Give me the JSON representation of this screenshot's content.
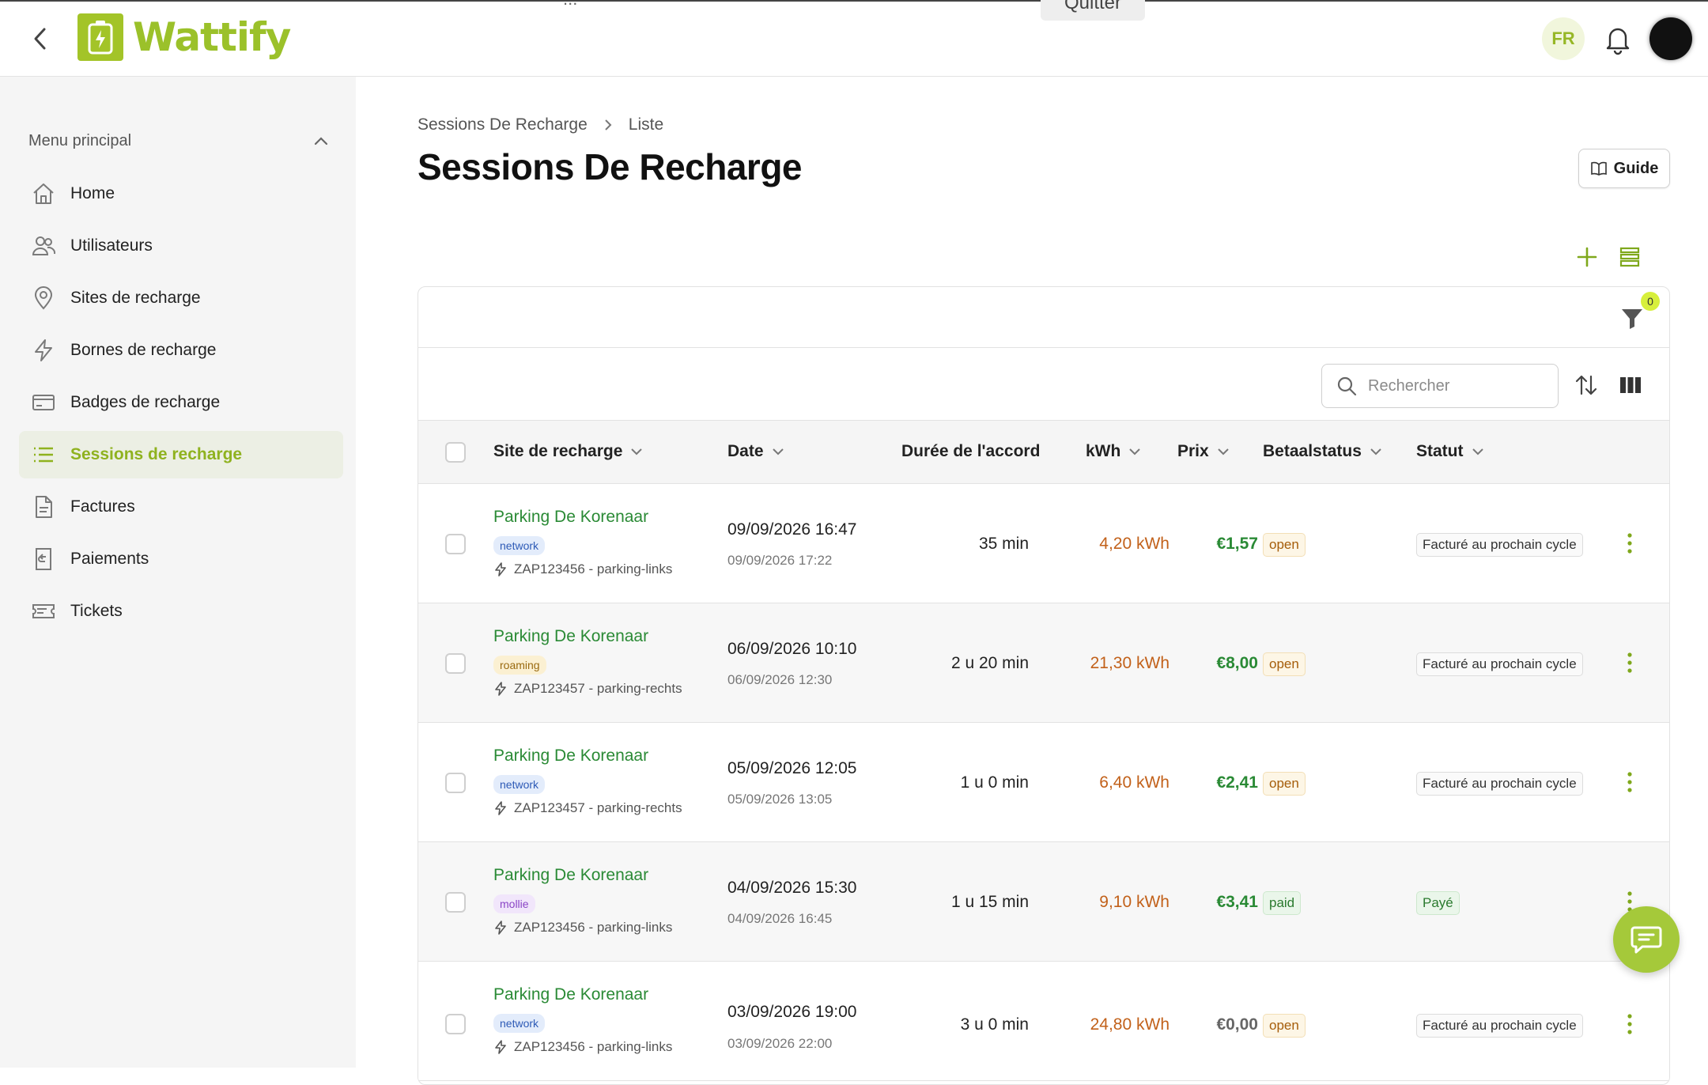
{
  "header": {
    "brand": "Wattify",
    "ghost_text": "...",
    "ghost_button": "Quitter",
    "lang": "FR",
    "accent": "#a3c428"
  },
  "sidebar": {
    "heading": "Menu principal",
    "items": [
      {
        "label": "Home",
        "icon": "home-icon"
      },
      {
        "label": "Utilisateurs",
        "icon": "users-icon"
      },
      {
        "label": "Sites de recharge",
        "icon": "map-pin-icon"
      },
      {
        "label": "Bornes de recharge",
        "icon": "lightning-icon"
      },
      {
        "label": "Badges de recharge",
        "icon": "card-icon"
      },
      {
        "label": "Sessions de recharge",
        "icon": "list-icon",
        "active": true
      },
      {
        "label": "Factures",
        "icon": "document-icon"
      },
      {
        "label": "Paiements",
        "icon": "receipt-icon"
      },
      {
        "label": "Tickets",
        "icon": "ticket-icon"
      }
    ]
  },
  "breadcrumb": {
    "parent": "Sessions De Recharge",
    "current": "Liste"
  },
  "page": {
    "title": "Sessions De Recharge",
    "guide_label": "Guide"
  },
  "filters": {
    "count": "0"
  },
  "search": {
    "placeholder": "Rechercher"
  },
  "table": {
    "columns": [
      "Site de recharge",
      "Date",
      "Durée de l'accord",
      "kWh",
      "Prix",
      "Betaalstatus",
      "Statut"
    ],
    "rows": [
      {
        "site": "Parking De Korenaar",
        "tag": "network",
        "charger": "ZAP123456 - parking-links",
        "date": "09/09/2026 16:47",
        "date_end": "09/09/2026 17:22",
        "duration": "35 min",
        "kwh": "4,20 kWh",
        "prix": "€1,57",
        "pay": "open",
        "status": "Facturé au prochain cycle"
      },
      {
        "site": "Parking De Korenaar",
        "tag": "roaming",
        "charger": "ZAP123457 - parking-rechts",
        "date": "06/09/2026 10:10",
        "date_end": "06/09/2026 12:30",
        "duration": "2 u 20 min",
        "kwh": "21,30 kWh",
        "prix": "€8,00",
        "pay": "open",
        "status": "Facturé au prochain cycle"
      },
      {
        "site": "Parking De Korenaar",
        "tag": "network",
        "charger": "ZAP123457 - parking-rechts",
        "date": "05/09/2026 12:05",
        "date_end": "05/09/2026 13:05",
        "duration": "1 u 0 min",
        "kwh": "6,40 kWh",
        "prix": "€2,41",
        "pay": "open",
        "status": "Facturé au prochain cycle"
      },
      {
        "site": "Parking De Korenaar",
        "tag": "mollie",
        "charger": "ZAP123456 - parking-links",
        "date": "04/09/2026 15:30",
        "date_end": "04/09/2026 16:45",
        "duration": "1 u 15 min",
        "kwh": "9,10 kWh",
        "prix": "€3,41",
        "pay": "paid",
        "status": "Payé"
      },
      {
        "site": "Parking De Korenaar",
        "tag": "network",
        "charger": "ZAP123456 - parking-links",
        "date": "03/09/2026 19:00",
        "date_end": "03/09/2026 22:00",
        "duration": "3 u 0 min",
        "kwh": "24,80 kWh",
        "prix": "€0,00",
        "pay": "open",
        "status": "Facturé au prochain cycle"
      }
    ]
  }
}
